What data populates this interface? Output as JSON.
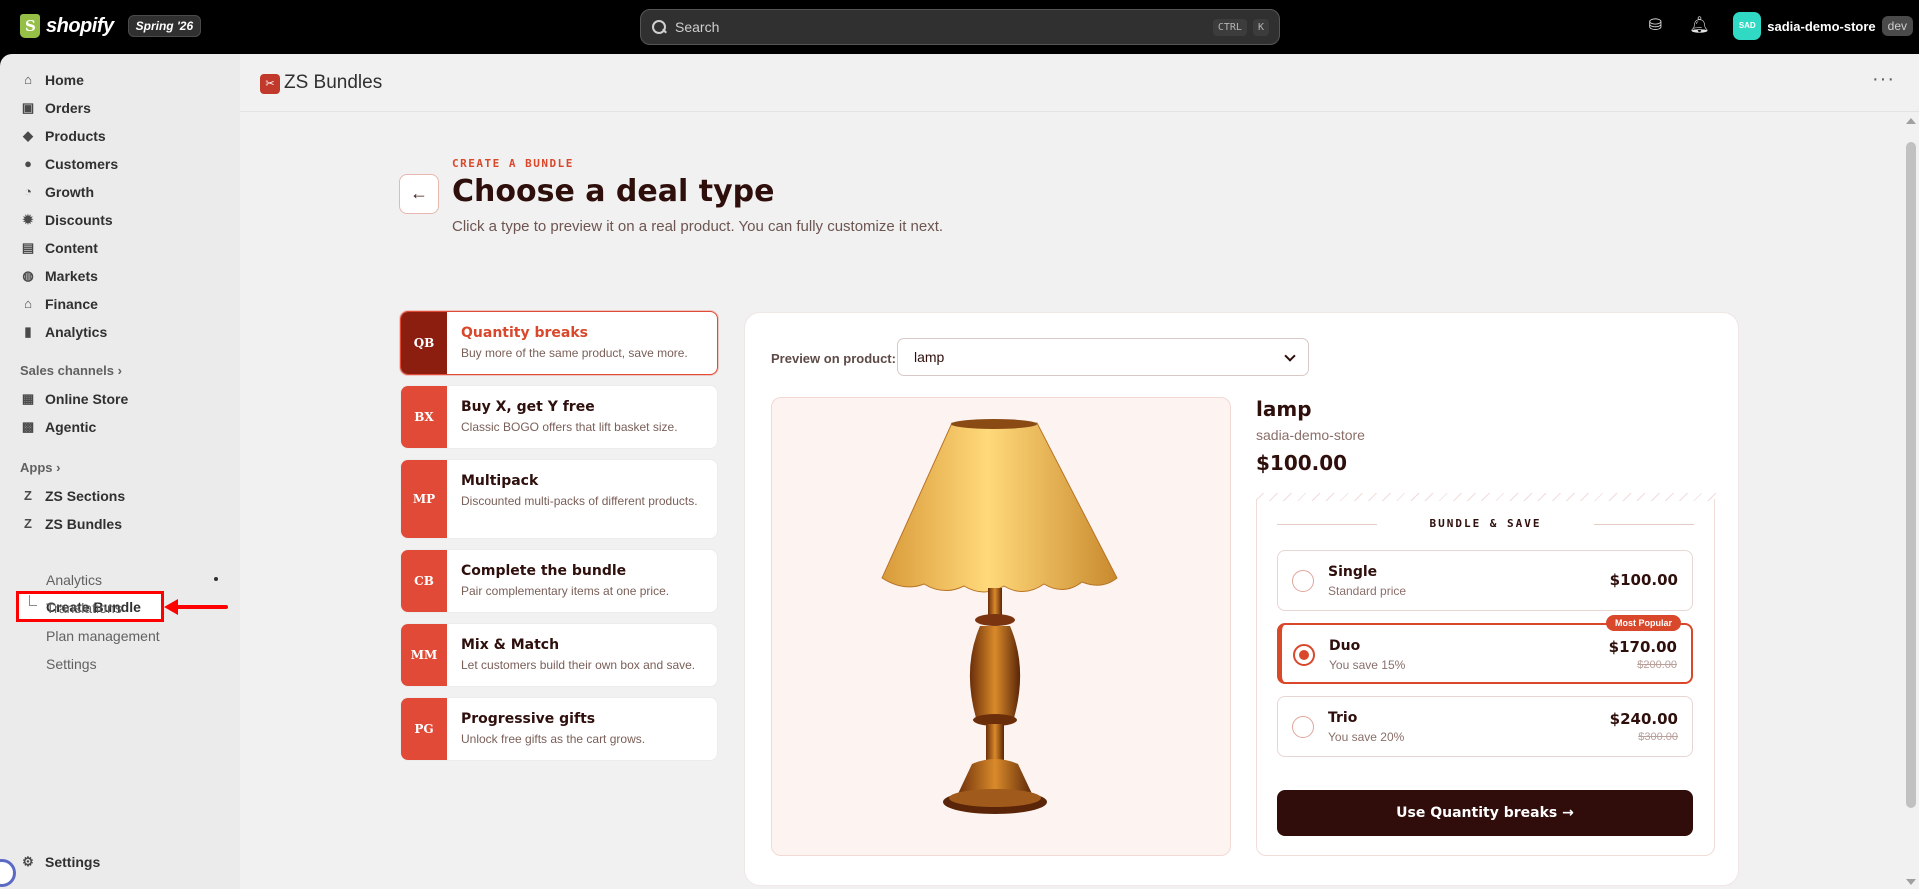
{
  "topbar": {
    "logo_text": "shopify",
    "edition_badge": "Spring '26",
    "search_placeholder": "Search",
    "shortcut_key1": "CTRL",
    "shortcut_key2": "K",
    "store_avatar": "SAD",
    "store_name": "sadia-demo-store",
    "env_badge": "dev"
  },
  "sidebar": {
    "items": [
      {
        "label": "Home",
        "icon": "home-icon"
      },
      {
        "label": "Orders",
        "icon": "inbox-icon"
      },
      {
        "label": "Products",
        "icon": "tag-icon"
      },
      {
        "label": "Customers",
        "icon": "person-icon"
      },
      {
        "label": "Growth",
        "icon": "gauge-icon"
      },
      {
        "label": "Discounts",
        "icon": "discount-icon"
      },
      {
        "label": "Content",
        "icon": "content-icon"
      },
      {
        "label": "Markets",
        "icon": "globe-icon"
      },
      {
        "label": "Finance",
        "icon": "bank-icon"
      },
      {
        "label": "Analytics",
        "icon": "bar-chart-icon"
      }
    ],
    "sales_channels_label": "Sales channels",
    "channels": [
      {
        "label": "Online Store",
        "icon": "store-icon"
      },
      {
        "label": "Agentic",
        "icon": "agentic-icon"
      }
    ],
    "apps_label": "Apps",
    "apps": [
      {
        "label": "ZS Sections",
        "icon": "zs-app-icon"
      },
      {
        "label": "ZS Bundles",
        "icon": "zs-app-icon"
      }
    ],
    "subitems": [
      "Create Bundle",
      "Analytics",
      "Translations",
      "Plan management",
      "Settings"
    ],
    "settings_label": "Settings"
  },
  "app_header": {
    "title": "ZS Bundles"
  },
  "page": {
    "eyebrow": "CREATE A BUNDLE",
    "title": "Choose a deal type",
    "subtitle": "Click a type to preview it on a real product. You can fully customize it next."
  },
  "deal_types": [
    {
      "tag": "QB",
      "name": "Quantity breaks",
      "desc": "Buy more of the same product, save more."
    },
    {
      "tag": "BX",
      "name": "Buy X, get Y free",
      "desc": "Classic BOGO offers that lift basket size."
    },
    {
      "tag": "MP",
      "name": "Multipack",
      "desc": "Discounted multi-packs of different products."
    },
    {
      "tag": "CB",
      "name": "Complete the bundle",
      "desc": "Pair complementary items at one price."
    },
    {
      "tag": "MM",
      "name": "Mix & Match",
      "desc": "Let customers build their own box and save."
    },
    {
      "tag": "PG",
      "name": "Progressive gifts",
      "desc": "Unlock free gifts as the cart grows."
    }
  ],
  "preview": {
    "label": "Preview on product:",
    "selected_product": "lamp",
    "product_title": "lamp",
    "vendor": "sadia-demo-store",
    "price": "$100.00",
    "bundle_heading": "BUNDLE & SAVE",
    "tiers": [
      {
        "name": "Single",
        "sub": "Standard price",
        "price": "$100.00",
        "original": ""
      },
      {
        "name": "Duo",
        "sub": "You save 15%",
        "price": "$170.00",
        "original": "$200.00",
        "badge": "Most Popular"
      },
      {
        "name": "Trio",
        "sub": "You save 20%",
        "price": "$240.00",
        "original": "$300.00"
      }
    ],
    "cta": "Use Quantity breaks →"
  },
  "colors": {
    "accent": "#d9482b",
    "dark": "#300c0a",
    "annotation": "#ff0000"
  }
}
